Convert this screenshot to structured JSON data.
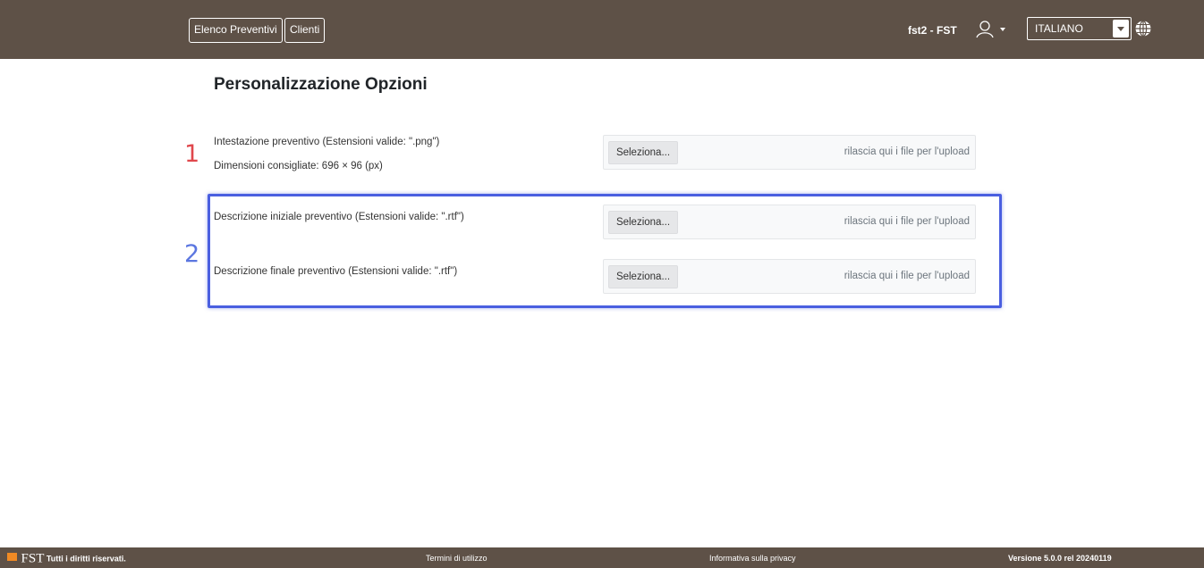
{
  "header": {
    "nav": [
      "Elenco Preventivi",
      "Clienti"
    ],
    "user_label": "fst2 - FST",
    "user_icon": "user-icon",
    "language": {
      "selected": "ITALIANO"
    },
    "globe_icon": "globe-icon"
  },
  "main": {
    "title": "Personalizzazione Opzioni",
    "rows": [
      {
        "label": "Intestazione preventivo (Estensioni valide: \".png\")",
        "hint": "Dimensioni consigliate: 696 × 96 (px)",
        "button": "Seleziona...",
        "drop_text": "rilascia qui i file per l'upload"
      },
      {
        "label": "Descrizione iniziale preventivo (Estensioni valide: \".rtf\")",
        "button": "Seleziona...",
        "drop_text": "rilascia qui i file per l'upload"
      },
      {
        "label": "Descrizione finale preventivo (Estensioni valide: \".rtf\")",
        "button": "Seleziona...",
        "drop_text": "rilascia qui i file per l'upload"
      }
    ],
    "markers": [
      "1",
      "2"
    ],
    "marker_colors": {
      "one": "#e0474c",
      "two": "#5b76e0"
    }
  },
  "footer": {
    "brand": "FST",
    "rights": "Tutti i diritti riservati.",
    "terms": "Termini di utilizzo",
    "privacy": "Informativa sulla privacy",
    "version": "Versione 5.0.0 rel 20240119"
  },
  "colors": {
    "bar": "#5e5147",
    "accent": "#f08a24",
    "highlight": "#4a5fe0"
  }
}
